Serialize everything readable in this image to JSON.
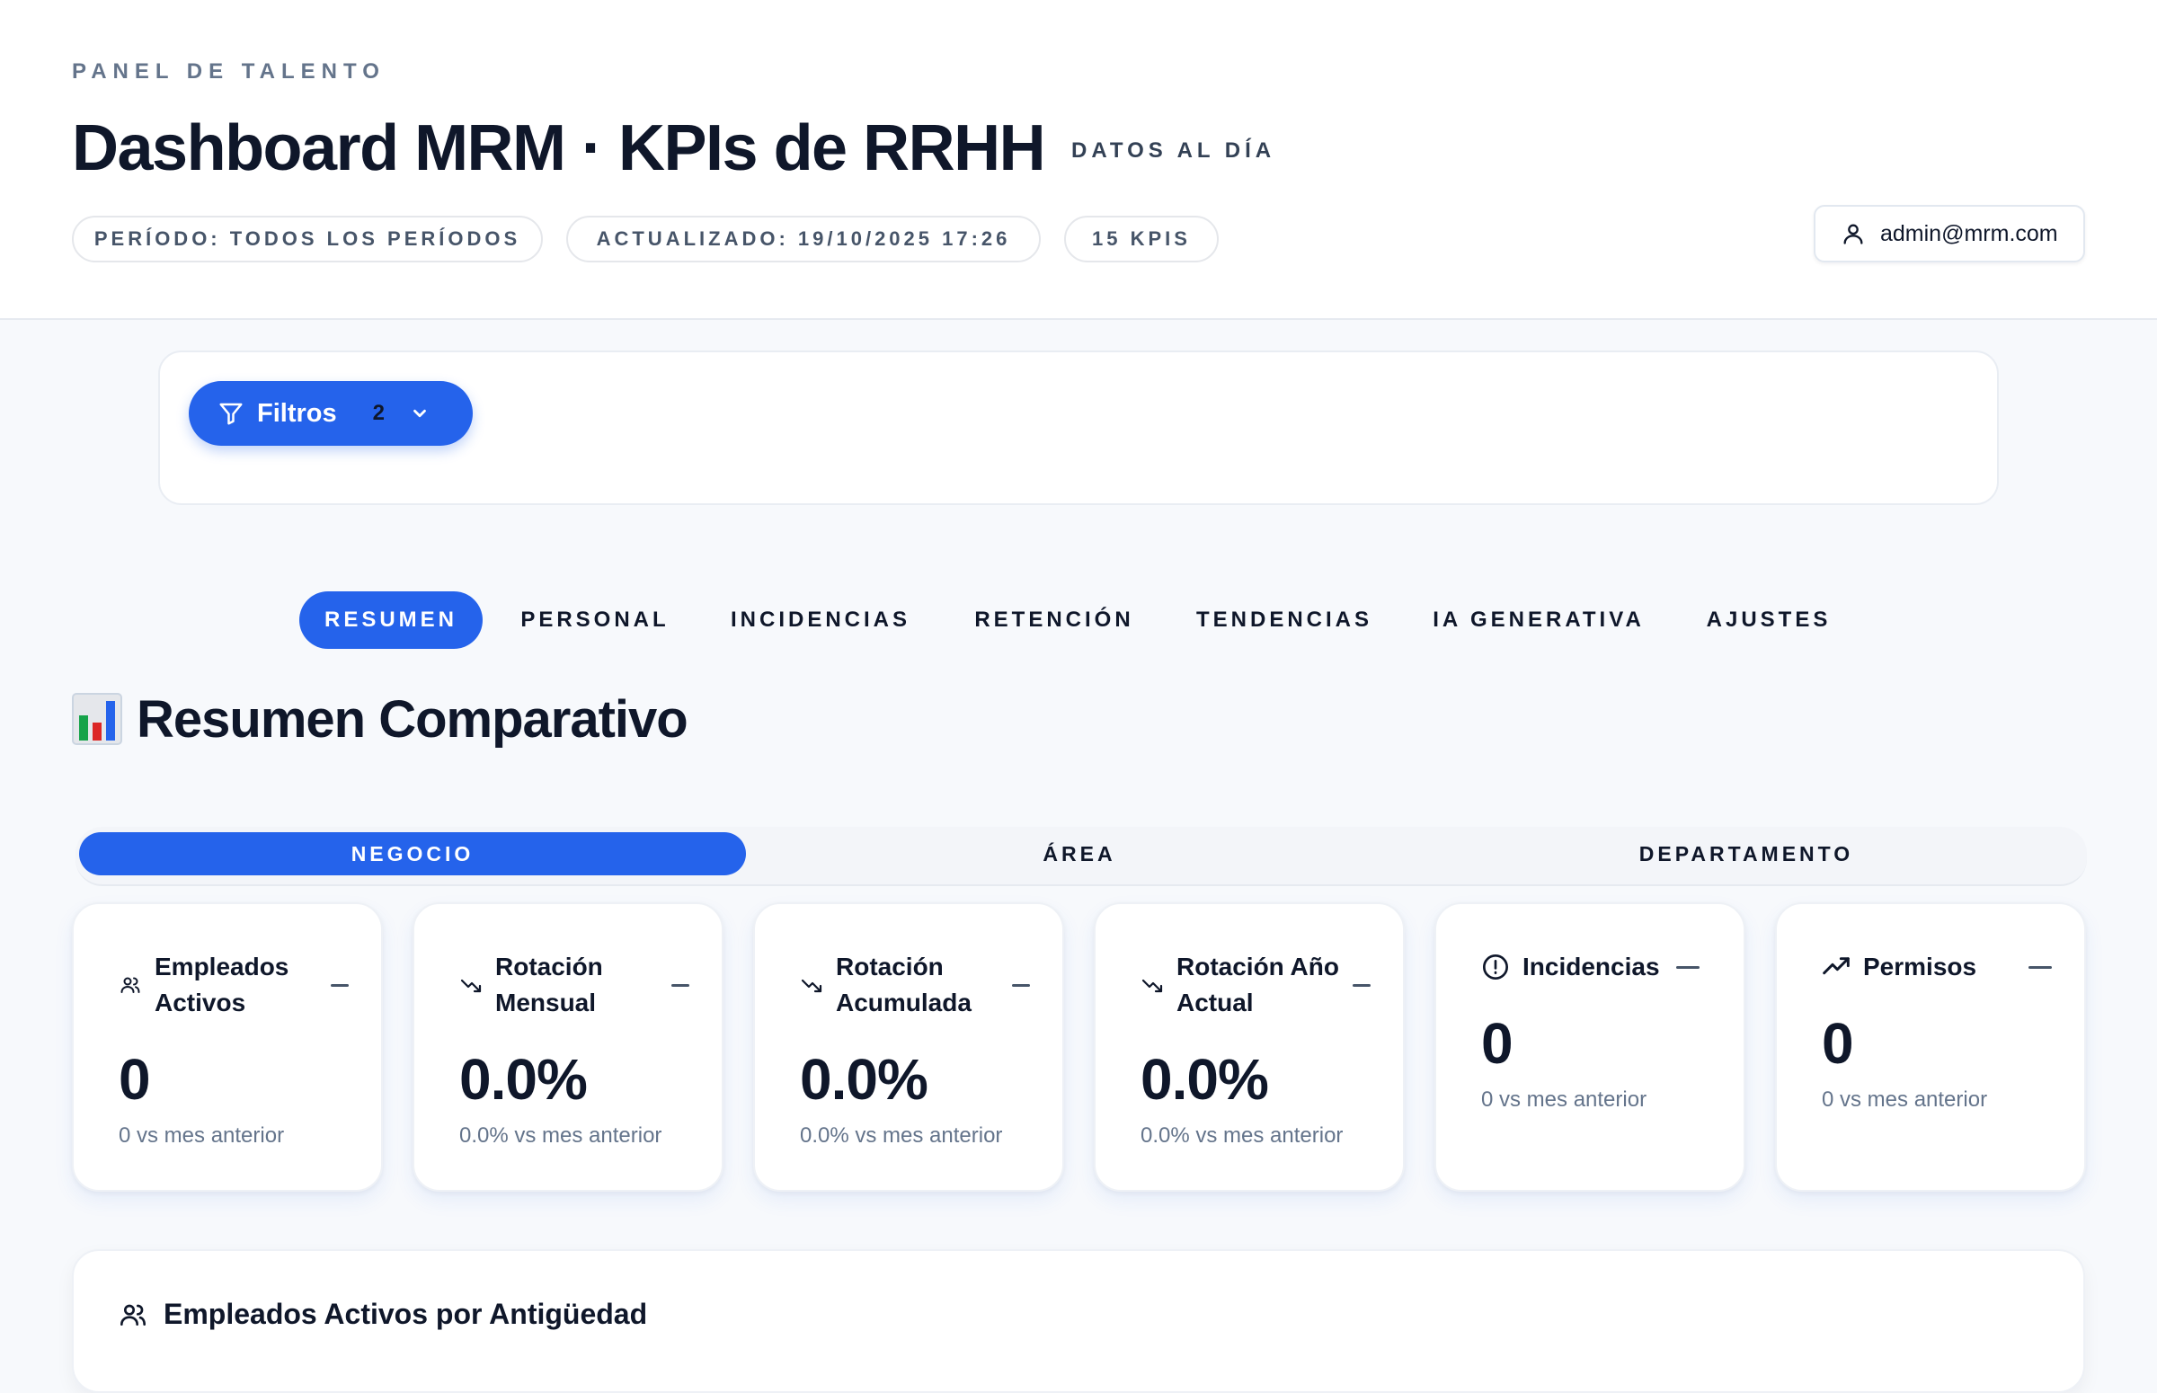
{
  "header": {
    "eyebrow": "PANEL DE TALENTO",
    "title": "Dashboard MRM · KPIs de RRHH",
    "live_label": "DATOS AL DÍA",
    "chips": [
      "PERÍODO: TODOS LOS PERÍODOS",
      "ACTUALIZADO: 19/10/2025 17:26",
      "15 KPIS"
    ],
    "user_email": "admin@mrm.com"
  },
  "filters": {
    "label": "Filtros",
    "count": "2"
  },
  "tabs": [
    {
      "label": "RESUMEN",
      "active": true
    },
    {
      "label": "PERSONAL",
      "active": false
    },
    {
      "label": "INCIDENCIAS",
      "active": false
    },
    {
      "label": "RETENCIÓN",
      "active": false
    },
    {
      "label": "TENDENCIAS",
      "active": false
    },
    {
      "label": "IA GENERATIVA",
      "active": false
    },
    {
      "label": "AJUSTES",
      "active": false
    }
  ],
  "section": {
    "title": "Resumen Comparativo"
  },
  "segment": [
    {
      "label": "NEGOCIO",
      "active": true
    },
    {
      "label": "ÁREA",
      "active": false
    },
    {
      "label": "DEPARTAMENTO",
      "active": false
    }
  ],
  "kpis": [
    {
      "title": "Empleados Activos",
      "value": "0",
      "subtitle": "0 vs mes anterior",
      "icon": "users-icon"
    },
    {
      "title": "Rotación Mensual",
      "value": "0.0%",
      "subtitle": "0.0% vs mes anterior",
      "icon": "trending-down-icon"
    },
    {
      "title": "Rotación Acumulada",
      "value": "0.0%",
      "subtitle": "0.0% vs mes anterior",
      "icon": "trending-down-icon"
    },
    {
      "title": "Rotación Año Actual",
      "value": "0.0%",
      "subtitle": "0.0% vs mes anterior",
      "icon": "trending-down-icon"
    },
    {
      "title": "Incidencias",
      "value": "0",
      "subtitle": "0 vs mes anterior",
      "icon": "alert-circle-icon"
    },
    {
      "title": "Permisos",
      "value": "0",
      "subtitle": "0 vs mes anterior",
      "icon": "trending-up-icon"
    }
  ],
  "bottom_card": {
    "title": "Empleados Activos por Antigüedad"
  },
  "colors": {
    "accent": "#2563eb",
    "text": "#0f172a",
    "muted": "#64748b"
  }
}
